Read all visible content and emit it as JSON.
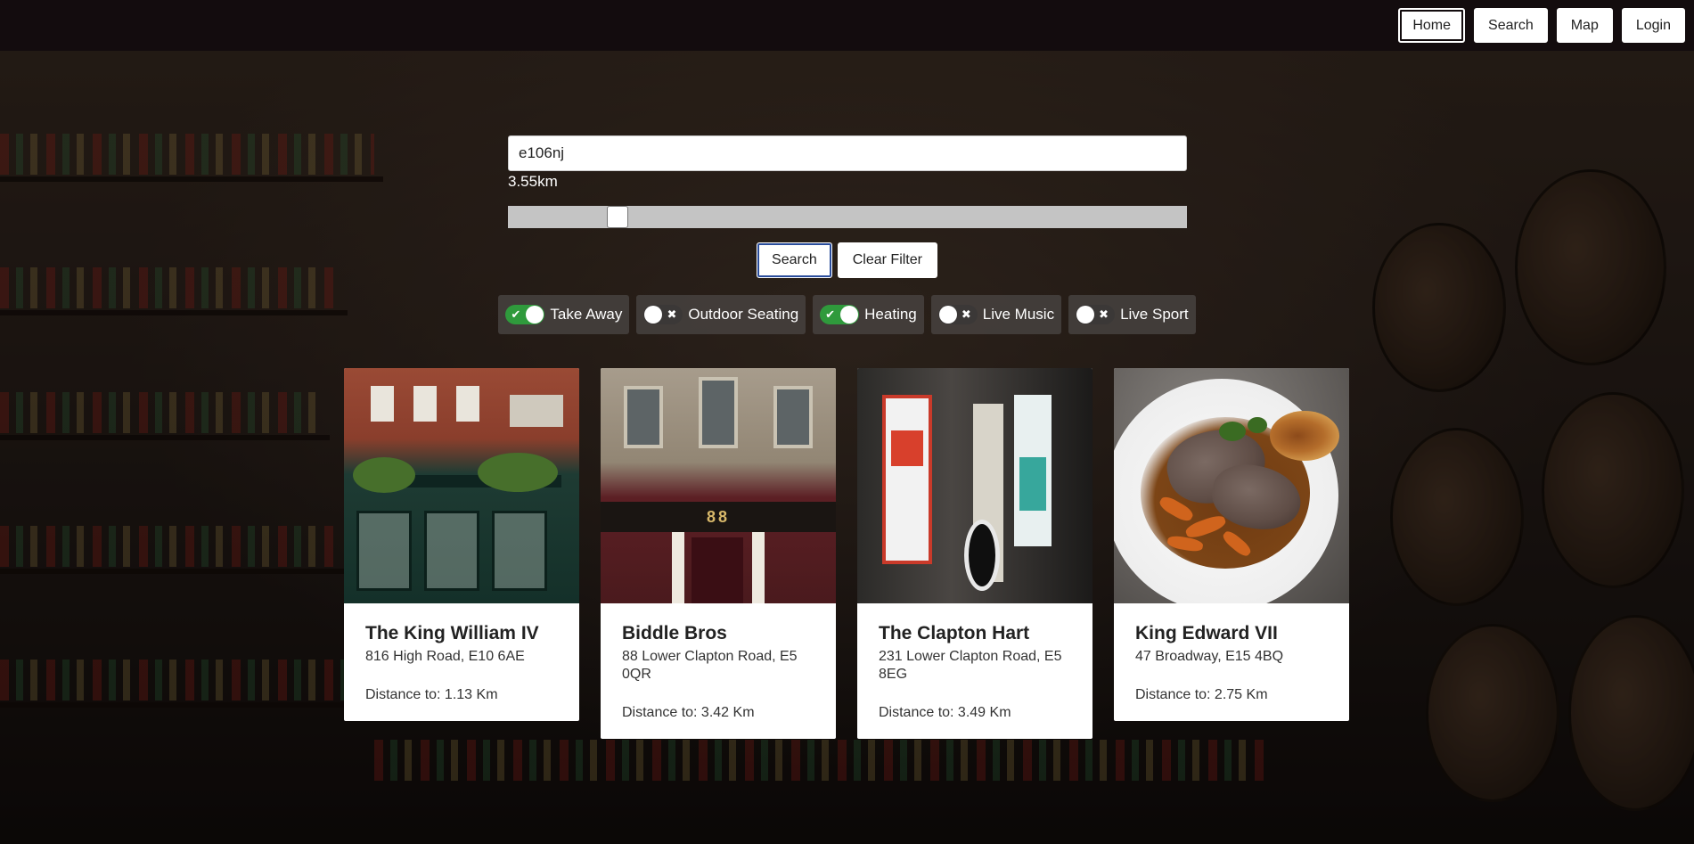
{
  "nav": {
    "home": "Home",
    "search": "Search",
    "map": "Map",
    "login": "Login"
  },
  "search": {
    "query": "e106nj",
    "radius_label": "3.55km",
    "radius_fraction": 0.15,
    "search_button": "Search",
    "clear_button": "Clear Filter"
  },
  "filters": [
    {
      "label": "Take Away",
      "on": true
    },
    {
      "label": "Outdoor Seating",
      "on": false
    },
    {
      "label": "Heating",
      "on": true
    },
    {
      "label": "Live Music",
      "on": false
    },
    {
      "label": "Live Sport",
      "on": false
    }
  ],
  "icons": {
    "check": "check-icon",
    "cross": "cross-icon"
  },
  "colors": {
    "toggle_on": "#2f9a3c",
    "toggle_off": "#3b3837",
    "topbar": "#130c0e"
  },
  "pubs": [
    {
      "name": "The King William IV",
      "address": "816 High Road, E10 6AE",
      "distance": "Distance to: 1.13 Km"
    },
    {
      "name": "Biddle Bros",
      "address": "88 Lower Clapton Road, E5 0QR",
      "distance": "Distance to: 3.42 Km"
    },
    {
      "name": "The Clapton Hart",
      "address": "231 Lower Clapton Road, E5 8EG",
      "distance": "Distance to: 3.49 Km"
    },
    {
      "name": "King Edward VII",
      "address": "47 Broadway, E15 4BQ",
      "distance": "Distance to: 2.75 Km"
    }
  ],
  "images": {
    "biddle_sign": "88"
  }
}
